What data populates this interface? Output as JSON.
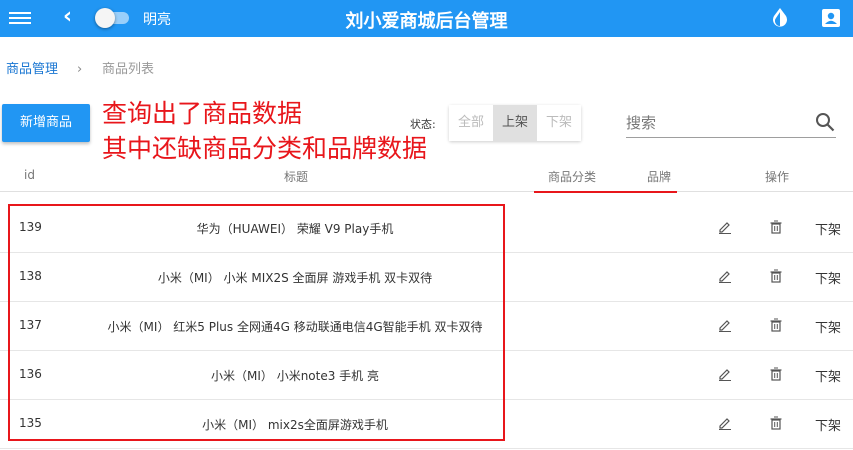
{
  "appbar": {
    "theme_label": "明亮",
    "title": "刘小爱商城后台管理",
    "icons": [
      "menu-icon",
      "chevron-left-icon",
      "theme-toggle",
      "invert-colors-icon",
      "account-box-icon"
    ],
    "color": "#2196f3"
  },
  "breadcrumb": {
    "parent": "商品管理",
    "separator": "›",
    "current": "商品列表"
  },
  "toolbar": {
    "add_label": "新增商品",
    "status_label": "状态:",
    "status_options": [
      "全部",
      "上架",
      "下架"
    ],
    "status_selected": "上架",
    "search_placeholder": "搜索"
  },
  "annotation": {
    "line1": "查询出了商品数据",
    "line2": "其中还缺商品分类和品牌数据",
    "color": "#e8161b"
  },
  "table": {
    "headers": {
      "id": "id",
      "title": "标题",
      "category": "商品分类",
      "brand": "品牌",
      "actions": "操作"
    },
    "rows": [
      {
        "id": "139",
        "title": "华为（HUAWEI） 荣耀 V9 Play手机",
        "action": "下架"
      },
      {
        "id": "138",
        "title": "小米（MI） 小米 MIX2S 全面屏 游戏手机 双卡双待",
        "action": "下架"
      },
      {
        "id": "137",
        "title": "小米（MI） 红米5 Plus 全网通4G 移动联通电信4G智能手机 双卡双待",
        "action": "下架"
      },
      {
        "id": "136",
        "title": "小米（MI） 小米note3 手机 亮",
        "action": "下架"
      },
      {
        "id": "135",
        "title": "小米（MI） mix2s全面屏游戏手机",
        "action": "下架"
      }
    ]
  }
}
